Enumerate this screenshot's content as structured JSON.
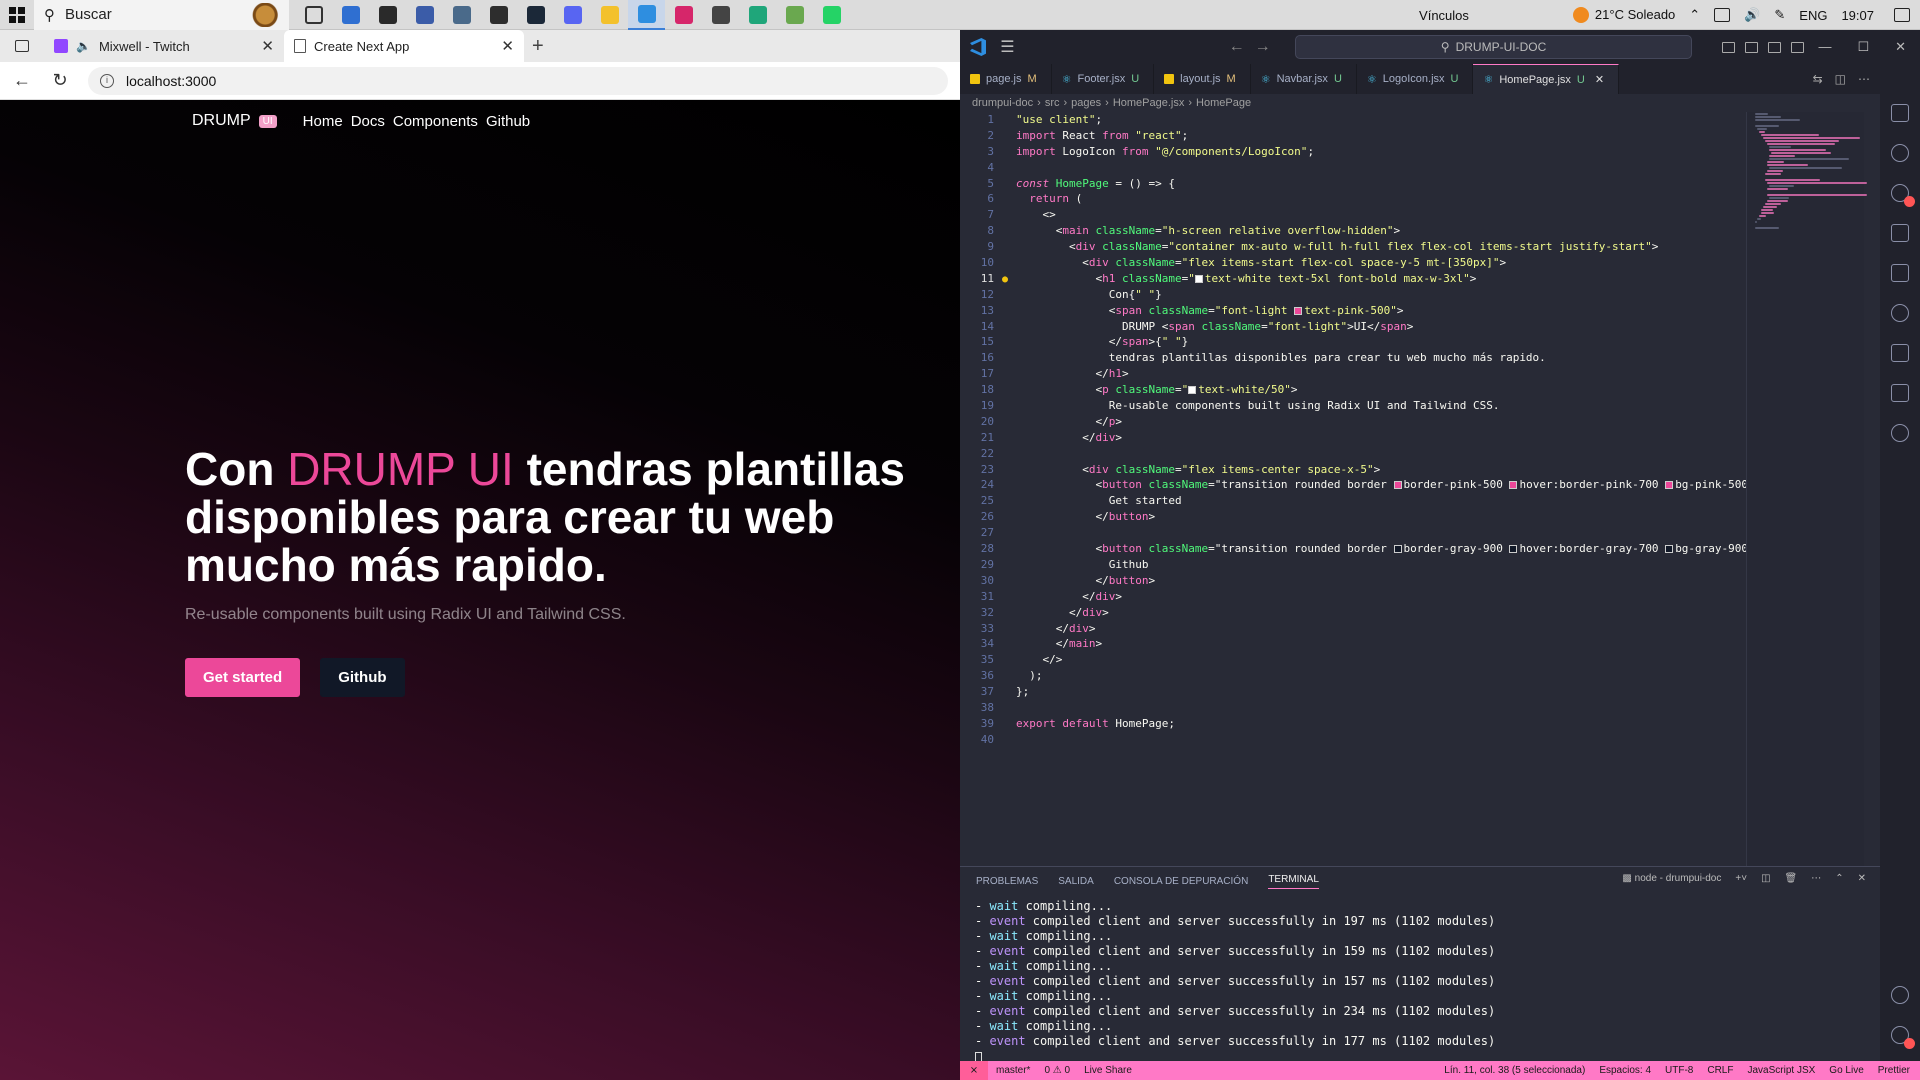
{
  "taskbar": {
    "search_placeholder": "Buscar",
    "icons": [
      {
        "name": "task-view-icon",
        "color": "#333333"
      },
      {
        "name": "store-icon",
        "color": "#2f6fd1"
      },
      {
        "name": "obs-icon",
        "color": "#2a2a2a"
      },
      {
        "name": "wps-icon",
        "color": "#3b5ca8"
      },
      {
        "name": "calculator-icon",
        "color": "#4a6a8a"
      },
      {
        "name": "terminal-icon",
        "color": "#2d2d2d"
      },
      {
        "name": "steam-icon",
        "color": "#1b2838"
      },
      {
        "name": "discord-icon",
        "color": "#5865f2"
      },
      {
        "name": "file-explorer-icon",
        "color": "#f3c12c"
      },
      {
        "name": "vscode-icon",
        "color": "#2e8ee0"
      },
      {
        "name": "jetbrains-icon",
        "color": "#d6266a"
      },
      {
        "name": "notion-icon",
        "color": "#444444"
      },
      {
        "name": "edge-icon",
        "color": "#1fa67a"
      },
      {
        "name": "minecraft-icon",
        "color": "#6aa84f"
      },
      {
        "name": "whatsapp-icon",
        "color": "#25d366"
      }
    ],
    "tray": {
      "links_label": "Vínculos",
      "weather": "21°C  Soleado",
      "lang": "ENG",
      "time": "19:07"
    }
  },
  "browser": {
    "tabs": [
      {
        "title": "Mixwell - Twitch",
        "icon": "twitch-icon"
      },
      {
        "title": "Create Next App",
        "icon": "page-icon"
      }
    ],
    "new_tab_glyph": "+",
    "url": "localhost:3000"
  },
  "site": {
    "brand": "DRUMP",
    "brand_badge": "UI",
    "nav_links": [
      "Home",
      "Docs",
      "Components",
      "Github"
    ],
    "hero_prefix": "Con ",
    "hero_highlight": "DRUMP UI",
    "hero_rest": " tendras plantillas disponibles para crear tu web mucho más rapido.",
    "subtitle": "Re-usable components built using Radix UI and Tailwind CSS.",
    "buttons": {
      "primary": "Get started",
      "secondary": "Github"
    },
    "colors": {
      "accent": "#ec4899",
      "dark_button": "#111827"
    }
  },
  "vscode": {
    "command_center": "DRUMP-UI-DOC",
    "tabs": [
      {
        "label": "page.js",
        "status": "M",
        "icon": "js"
      },
      {
        "label": "Footer.jsx",
        "status": "U",
        "icon": "react"
      },
      {
        "label": "layout.js",
        "status": "M",
        "icon": "js"
      },
      {
        "label": "Navbar.jsx",
        "status": "U",
        "icon": "react"
      },
      {
        "label": "LogoIcon.jsx",
        "status": "U",
        "icon": "react"
      },
      {
        "label": "HomePage.jsx",
        "status": "U",
        "icon": "react",
        "active": true
      }
    ],
    "breadcrumbs": [
      "drumpui-doc",
      "src",
      "pages",
      "HomePage.jsx",
      "HomePage"
    ],
    "current_line": 11,
    "code_lines": [
      "\"use client\";",
      "import React from \"react\";",
      "import LogoIcon from \"@/components/LogoIcon\";",
      "",
      "const HomePage = () => {",
      "  return (",
      "    <>",
      "      <main className=\"h-screen relative overflow-hidden\">",
      "        <div className=\"container mx-auto w-full h-full flex flex-col items-start justify-start\">",
      "          <div className=\"flex items-start flex-col space-y-5 mt-[350px]\">",
      "            <h1 className=\"text-white text-5xl font-bold max-w-3xl\">",
      "              Con{\" \"}",
      "              <span className=\"font-light text-pink-500\">",
      "                DRUMP <span className=\"font-light\">UI</span>",
      "              </span>{\" \"}",
      "              tendras plantillas disponibles para crear tu web mucho más rapido.",
      "            </h1>",
      "            <p className=\"text-white/50\">",
      "              Re-usable components built using Radix UI and Tailwind CSS.",
      "            </p>",
      "          </div>",
      "",
      "          <div className=\"flex items-center space-x-5\">",
      "            <button className=\"transition rounded border border-pink-500 hover:border-pink-700 bg-pink-500",
      "              Get started",
      "            </button>",
      "",
      "            <button className=\"transition rounded border border-gray-900 hover:border-gray-700 bg-gray-900",
      "              Github",
      "            </button>",
      "          </div>",
      "        </div>",
      "      </div>",
      "      </main>",
      "    </>",
      "  );",
      "};",
      "",
      "export default HomePage;",
      ""
    ],
    "panel_tabs": [
      "PROBLEMAS",
      "SALIDA",
      "CONSOLA DE DEPURACIÓN",
      "TERMINAL"
    ],
    "active_panel_tab": "TERMINAL",
    "terminal_name": "node - drumpui-doc",
    "terminal_lines": [
      {
        "kind": "wait",
        "text": "compiling..."
      },
      {
        "kind": "event",
        "text": "compiled client and server successfully in 197 ms (1102 modules)"
      },
      {
        "kind": "wait",
        "text": "compiling..."
      },
      {
        "kind": "event",
        "text": "compiled client and server successfully in 159 ms (1102 modules)"
      },
      {
        "kind": "wait",
        "text": "compiling..."
      },
      {
        "kind": "event",
        "text": "compiled client and server successfully in 157 ms (1102 modules)"
      },
      {
        "kind": "wait",
        "text": "compiling..."
      },
      {
        "kind": "event",
        "text": "compiled client and server successfully in 234 ms (1102 modules)"
      },
      {
        "kind": "wait",
        "text": "compiling..."
      },
      {
        "kind": "event",
        "text": "compiled client and server successfully in 177 ms (1102 modules)"
      }
    ],
    "status_left": [
      "master*",
      "0 ⚠ 0",
      "Live Share"
    ],
    "status_right": [
      "Lín. 11, col. 38 (5 seleccionada)",
      "Espacios: 4",
      "UTF-8",
      "CRLF",
      "JavaScript JSX",
      "Go Live",
      "Prettier"
    ],
    "colors": {
      "status_bar": "#ff79c6",
      "editor_bg": "#282a36"
    }
  }
}
